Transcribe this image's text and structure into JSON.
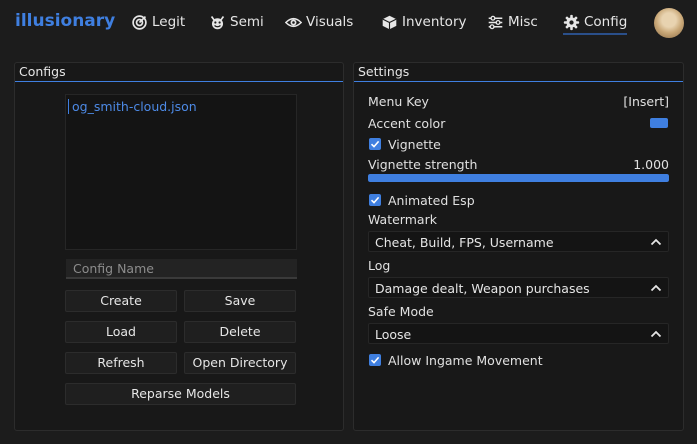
{
  "brand": "illusionary",
  "nav": [
    {
      "label": "Legit",
      "icon": "target-icon"
    },
    {
      "label": "Semi",
      "icon": "devil-icon"
    },
    {
      "label": "Visuals",
      "icon": "eye-icon"
    },
    {
      "label": "Inventory",
      "icon": "box-icon"
    },
    {
      "label": "Misc",
      "icon": "sliders-icon"
    },
    {
      "label": "Config",
      "icon": "gear-icon",
      "active": true
    }
  ],
  "configs": {
    "title": "Configs",
    "files": [
      "og_smith-cloud.json"
    ],
    "name_placeholder": "Config Name",
    "buttons": {
      "create": "Create",
      "save": "Save",
      "load": "Load",
      "delete": "Delete",
      "refresh": "Refresh",
      "open_directory": "Open Directory",
      "reparse_models": "Reparse Models"
    }
  },
  "settings": {
    "title": "Settings",
    "menu_key": {
      "label": "Menu Key",
      "value": "[Insert]"
    },
    "accent_color": {
      "label": "Accent color",
      "color": "#3f7fe0"
    },
    "vignette": {
      "label": "Vignette",
      "checked": true
    },
    "vignette_strength": {
      "label": "Vignette strength",
      "value": "1.000",
      "fraction": 1.0
    },
    "animated_esp": {
      "label": "Animated Esp",
      "checked": true
    },
    "watermark": {
      "label": "Watermark",
      "value": "Cheat, Build, FPS, Username"
    },
    "log": {
      "label": "Log",
      "value": "Damage dealt, Weapon purchases"
    },
    "safe_mode": {
      "label": "Safe Mode",
      "value": "Loose"
    },
    "allow_ingame_movement": {
      "label": "Allow Ingame Movement",
      "checked": true
    }
  },
  "colors": {
    "accent": "#3f7fe0",
    "background": "#1c1c1c",
    "panel": "#181818"
  }
}
